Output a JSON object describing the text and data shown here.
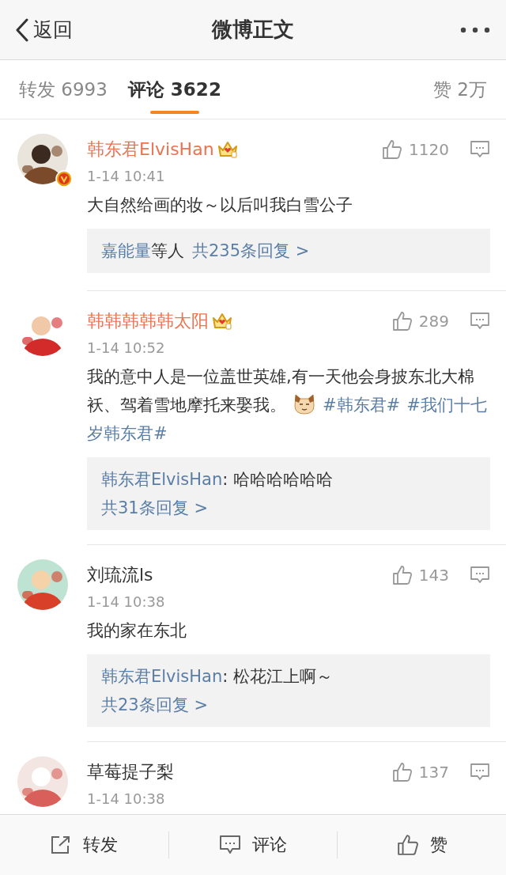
{
  "header": {
    "back_label": "返回",
    "title": "微博正文"
  },
  "tabs": [
    {
      "label": "转发",
      "count": "6993",
      "selected": false
    },
    {
      "label": "评论",
      "count": "3622",
      "selected": true
    },
    {
      "label": "赞",
      "count": "2万",
      "selected": false
    }
  ],
  "comments": [
    {
      "name": "韩东君ElvisHan",
      "vip": true,
      "verified": true,
      "time": "1-14 10:41",
      "likes": "1120",
      "text": [
        {
          "kind": "text",
          "text": "大自然给画的妆～以后叫我白雪公子"
        }
      ],
      "reply": {
        "kind": "summary",
        "names": "嘉能量",
        "suffix": "等人",
        "count": "共235条回复 >"
      }
    },
    {
      "name": "韩韩韩韩韩太阳",
      "vip": true,
      "verified": false,
      "time": "1-14 10:52",
      "likes": "289",
      "text": [
        {
          "kind": "text",
          "text": "我的意中人是一位盖世英雄,有一天他会身披东北大棉袄、驾着雪地摩托来娶我。"
        },
        {
          "kind": "emoji"
        },
        {
          "kind": "topic",
          "text": "#韩东君#"
        },
        {
          "kind": "topic",
          "text": "#我们十七岁韩东君#"
        }
      ],
      "reply": {
        "kind": "quote",
        "author": "韩东君ElvisHan",
        "quote": ": 哈哈哈哈哈哈",
        "count": "共31条回复 >"
      }
    },
    {
      "name": "刘琉流ls",
      "vip": false,
      "verified": false,
      "time": "1-14 10:38",
      "likes": "143",
      "text": [
        {
          "kind": "text",
          "text": "我的家在东北"
        }
      ],
      "reply": {
        "kind": "quote",
        "author": "韩东君ElvisHan",
        "quote": ": 松花江上啊～",
        "count": "共23条回复 >"
      }
    },
    {
      "name": "草莓提子梨",
      "vip": false,
      "verified": false,
      "time": "1-14 10:38",
      "likes": "137"
    }
  ],
  "toolbar": [
    {
      "kind": "repost",
      "label": "转发"
    },
    {
      "kind": "comment",
      "label": "评论"
    },
    {
      "kind": "like",
      "label": "赞"
    }
  ]
}
